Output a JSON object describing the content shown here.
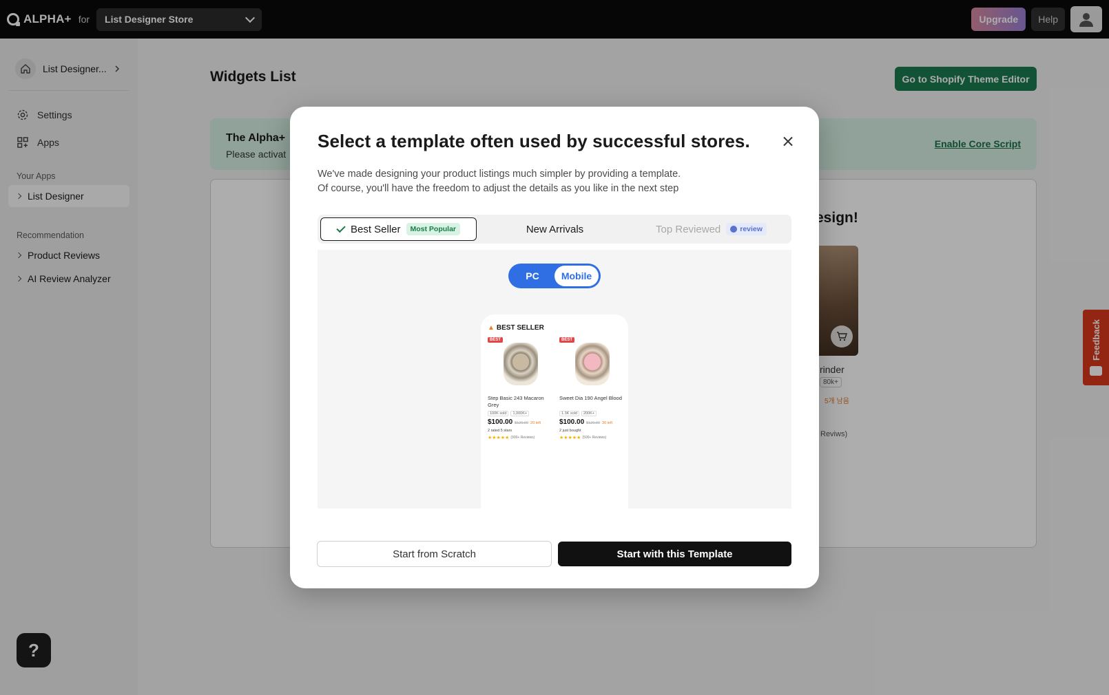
{
  "topbar": {
    "brand": "ALPHA+",
    "for_label": "for",
    "store_name": "List Designer Store",
    "upgrade_label": "Upgrade",
    "help_label": "Help",
    "avatar_icon": "user-icon",
    "upgrade_gradient": [
      "#d98aa0",
      "#9a7fd6"
    ]
  },
  "sidebar": {
    "app_home_label": "List Designer...",
    "nav": [
      {
        "label": "Settings",
        "icon": "gear-icon"
      },
      {
        "label": "Apps",
        "icon": "apps-grid-icon"
      }
    ],
    "your_apps_label": "Your Apps",
    "your_apps": [
      {
        "label": "List Designer"
      }
    ],
    "recommendation_label": "Recommendation",
    "recommendations": [
      {
        "label": "Product Reviews"
      },
      {
        "label": "AI Review Analyzer"
      }
    ],
    "help_fab": "?"
  },
  "main": {
    "title": "Widgets List",
    "theme_editor_button": "Go to Shopify Theme Editor",
    "banner": {
      "title": "The Alpha+",
      "subtitle": "Please activat",
      "link": "Enable Core Script"
    },
    "card": {
      "heading": "esign!",
      "product_name": "rinder",
      "chip": "80k+",
      "stock": "5개 남음",
      "reviews": "Reviws)"
    }
  },
  "feedback_tab": {
    "label": "Feedback",
    "color": "#d8381c"
  },
  "modal": {
    "title": "Select a template often used by successful stores.",
    "desc_line1": "We've made designing your product listings much simpler by providing a template.",
    "desc_line2": "Of course, you'll have the freedom to adjust the details as you like in the next step",
    "tabs": [
      {
        "label": "Best Seller",
        "badge": "Most Popular",
        "state": "selected"
      },
      {
        "label": "New Arrivals",
        "state": "normal"
      },
      {
        "label": "Top Reviewed",
        "badge": "review",
        "state": "disabled"
      }
    ],
    "view_toggle": {
      "pc": "PC",
      "mobile": "Mobile",
      "selected": "Mobile"
    },
    "preview": {
      "section_title": "BEST SELLER",
      "products": [
        {
          "tag": "BEST",
          "name": "Step Basic 243 Macaron Grey",
          "sold": "100K sold",
          "views": "1,000K+",
          "price": "$100.00",
          "orig_price": "$120.00",
          "discount": "20 left",
          "social": "2 rated 5 stars",
          "stars": "★★★★★",
          "review_count": "(900+ Reviews)"
        },
        {
          "tag": "BEST",
          "name": "Sweet Dia 190 Angel Blood",
          "sold": "1.3K sold",
          "views": "200K+",
          "price": "$100.00",
          "orig_price": "$120.00",
          "discount": "30 left",
          "social": "2 just bought",
          "stars": "★★★★★",
          "review_count": "(500+ Reviews)"
        }
      ]
    },
    "scratch_button": "Start from Scratch",
    "template_button": "Start with this Template",
    "accent_color": "#2f6fe3"
  }
}
